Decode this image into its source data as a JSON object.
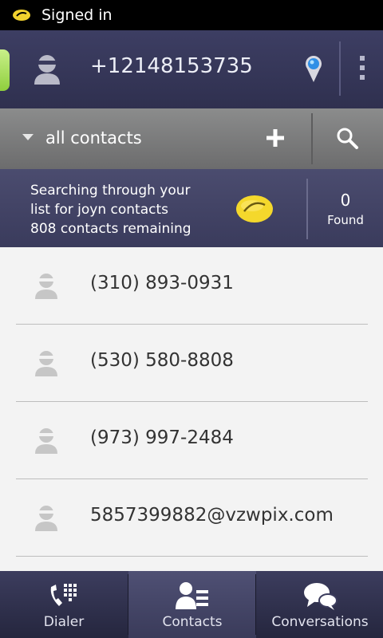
{
  "status_bar": {
    "text": "Signed in",
    "icon": "joyn-icon"
  },
  "header": {
    "phone_number": "+12148153735",
    "icons": [
      "avatar-icon",
      "location-pin-icon",
      "overflow-menu-icon"
    ]
  },
  "filter_bar": {
    "label": "all contacts",
    "icons": [
      "dropdown-caret-icon",
      "add-icon",
      "search-icon"
    ]
  },
  "search_status": {
    "line1": "Searching through your",
    "line2": "list for joyn contacts",
    "line3": "808 contacts remaining",
    "found_count": "0",
    "found_label": "Found"
  },
  "contacts": [
    {
      "name": "(310) 893-0931"
    },
    {
      "name": "(530) 580-8808"
    },
    {
      "name": "(973) 997-2484"
    },
    {
      "name": "5857399882@vzwpix.com"
    }
  ],
  "bottom_nav": {
    "items": [
      {
        "label": "Dialer",
        "icon": "dialpad-icon"
      },
      {
        "label": "Contacts",
        "icon": "contacts-icon",
        "active": true
      },
      {
        "label": "Conversations",
        "icon": "chat-bubbles-icon"
      }
    ]
  },
  "colors": {
    "accent_yellow": "#f2d22e",
    "header_bg": "#3d3e63",
    "list_bg": "#f3f3f3"
  }
}
